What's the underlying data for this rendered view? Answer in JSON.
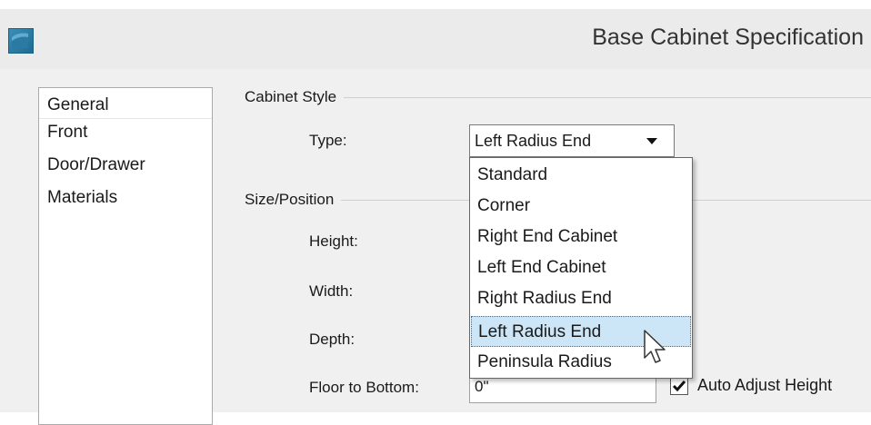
{
  "window": {
    "title": "Base Cabinet Specification"
  },
  "nav": {
    "items": [
      {
        "label": "General"
      },
      {
        "label": "Front"
      },
      {
        "label": "Door/Drawer"
      },
      {
        "label": "Materials"
      }
    ],
    "selected": "General"
  },
  "cabinet_style": {
    "group_label": "Cabinet Style",
    "type_label": "Type:",
    "type_value": "Left Radius End",
    "options": [
      {
        "label": "Standard"
      },
      {
        "label": "Corner"
      },
      {
        "label": "Right End Cabinet"
      },
      {
        "label": "Left End Cabinet"
      },
      {
        "label": "Right Radius End"
      },
      {
        "label": "Left Radius End"
      },
      {
        "label": "Peninsula Radius"
      }
    ],
    "highlighted_option": "Left Radius End"
  },
  "size_position": {
    "group_label": "Size/Position",
    "height_label": "Height:",
    "width_label": "Width:",
    "depth_label": "Depth:",
    "floor_to_bottom_label": "Floor to Bottom:",
    "floor_to_bottom_value": "0\"",
    "auto_adjust_label": "Auto Adjust Height",
    "auto_adjust_checked": true
  },
  "colors": {
    "titlebar_bg": "#ebebeb",
    "dialog_bg": "#f0f0f0",
    "highlight_bg": "#cde6f7"
  }
}
